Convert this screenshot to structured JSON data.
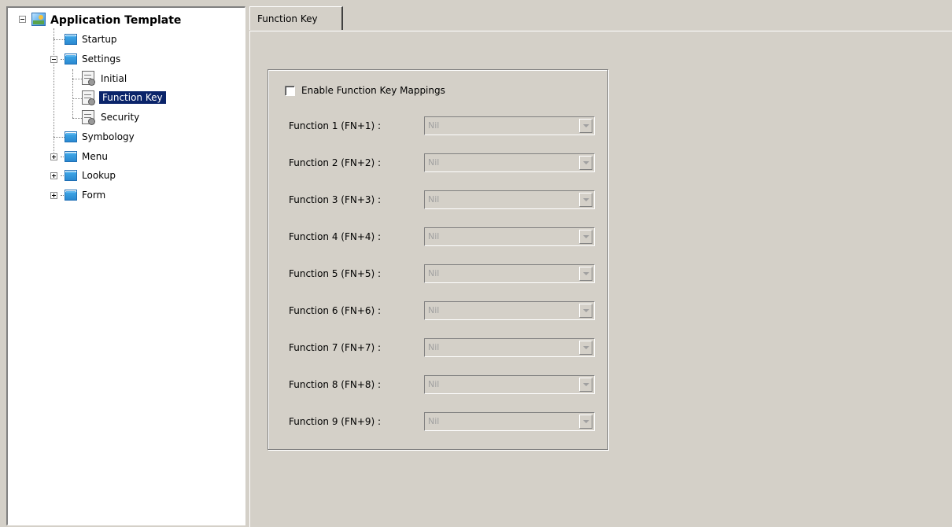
{
  "tree": {
    "root": {
      "label": "Application Template",
      "icon": "application-icon"
    },
    "nodes": [
      {
        "label": "Startup",
        "icon": "folder-icon"
      },
      {
        "label": "Settings",
        "icon": "folder-icon"
      },
      {
        "label": "Initial",
        "icon": "document-gear-icon"
      },
      {
        "label": "Function Key",
        "icon": "document-gear-icon",
        "selected": true
      },
      {
        "label": "Security",
        "icon": "document-gear-icon"
      },
      {
        "label": "Symbology",
        "icon": "folder-icon"
      },
      {
        "label": "Menu",
        "icon": "folder-icon"
      },
      {
        "label": "Lookup",
        "icon": "folder-icon"
      },
      {
        "label": "Form",
        "icon": "folder-icon"
      }
    ]
  },
  "tab": {
    "label": "Function Key"
  },
  "enable_mappings": {
    "label": "Enable Function Key Mappings",
    "checked": false
  },
  "functions": [
    {
      "label": "Function 1 (FN+1)  :",
      "value": "Nil"
    },
    {
      "label": "Function 2 (FN+2)  :",
      "value": "Nil"
    },
    {
      "label": "Function 3 (FN+3)  :",
      "value": "Nil"
    },
    {
      "label": "Function 4 (FN+4)  :",
      "value": "Nil"
    },
    {
      "label": "Function 5 (FN+5)  :",
      "value": "Nil"
    },
    {
      "label": "Function 6 (FN+6)  :",
      "value": "Nil"
    },
    {
      "label": "Function 7 (FN+7)  :",
      "value": "Nil"
    },
    {
      "label": "Function 8 (FN+8)  :",
      "value": "Nil"
    },
    {
      "label": "Function 9 (FN+9)  :",
      "value": "Nil"
    }
  ],
  "colors": {
    "selection": "#0a246a",
    "window_bg": "#d4d0c8",
    "disabled_text": "#a0a0a0"
  }
}
